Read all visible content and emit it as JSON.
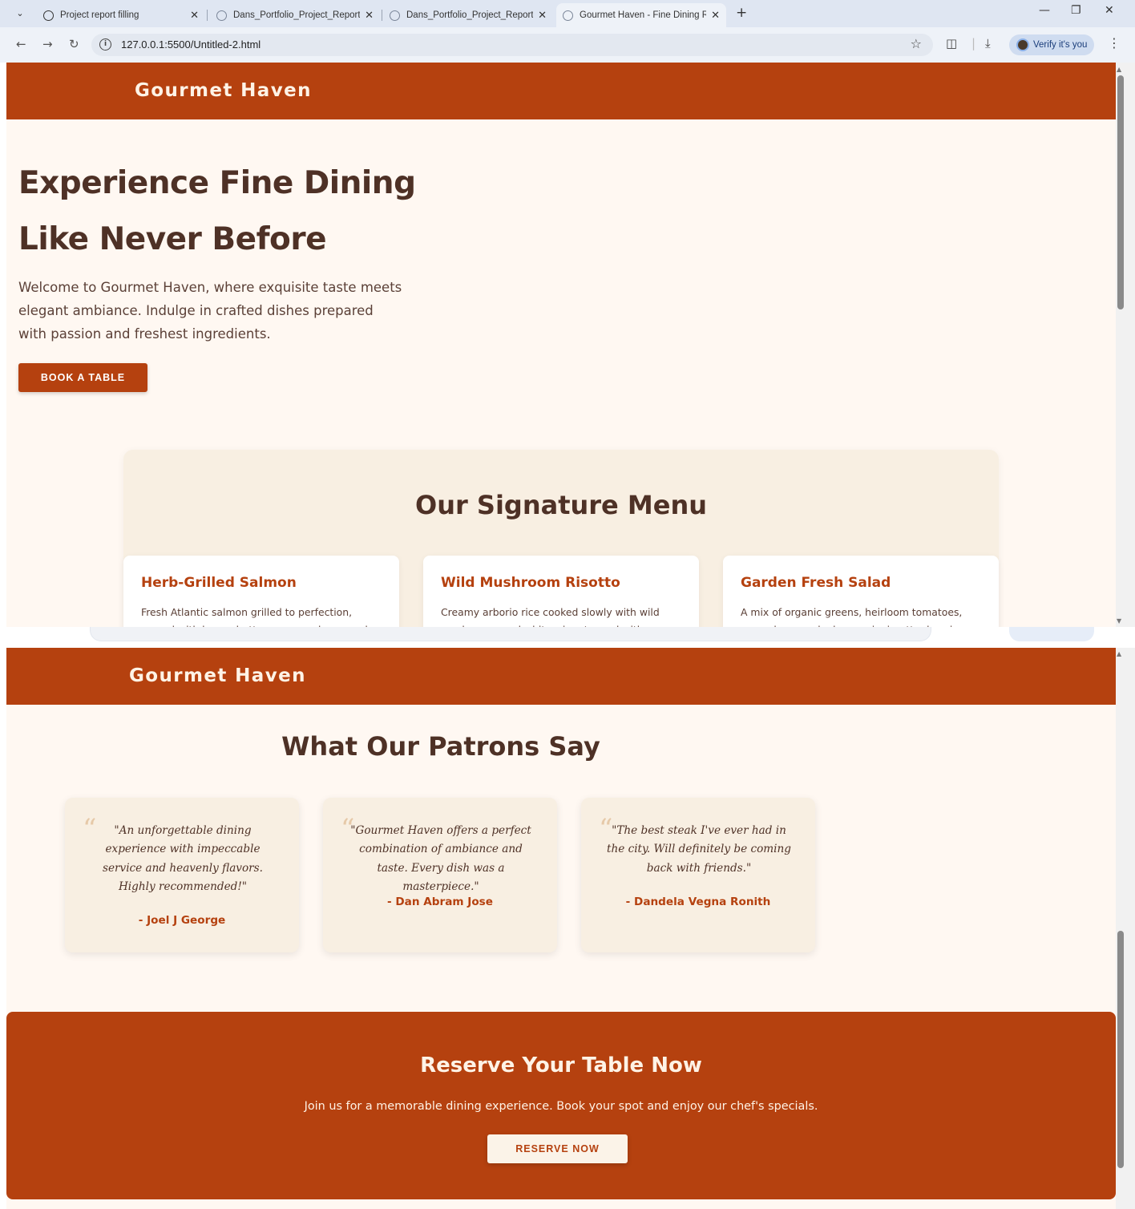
{
  "browser": {
    "tabs": [
      {
        "label": "Project report filling",
        "active": false
      },
      {
        "label": "Dans_Portfolio_Project_Report_",
        "active": false
      },
      {
        "label": "Dans_Portfolio_Project_Report.",
        "active": false
      },
      {
        "label": "Gourmet Haven - Fine Dining R",
        "active": true
      }
    ],
    "url": "127.0.0.1:5500/Untitled-2.html",
    "profile_label": "Verify it's you"
  },
  "colors": {
    "accent": "#b5410f",
    "page_bg": "#fff8f2",
    "card_bg": "#f8efe2",
    "heading": "#4e3126"
  },
  "header": {
    "brand": "Gourmet Haven"
  },
  "hero": {
    "title_line1": "Experience Fine Dining",
    "title_line2": "Like Never Before",
    "text": "Welcome to Gourmet Haven, where exquisite taste meets elegant ambiance. Indulge in crafted dishes prepared with passion and freshest ingredients.",
    "cta": "BOOK A TABLE"
  },
  "menu": {
    "title": "Our Signature Menu",
    "items": [
      {
        "name": "Herb-Grilled Salmon",
        "description": "Fresh Atlantic salmon grilled to perfection, served with lemon butter sauce and seasonal greens."
      },
      {
        "name": "Wild Mushroom Risotto",
        "description": "Creamy arborio rice cooked slowly with wild mushrooms and white wine, topped with Parmesan."
      },
      {
        "name": "Garden Fresh Salad",
        "description": "A mix of organic greens, heirloom tomatoes, cucumbers, and a house vinaigrette dressing."
      }
    ]
  },
  "testimonials": {
    "title": "What Our Patrons Say",
    "items": [
      {
        "quote": "\"An unforgettable dining experience with impeccable service and heavenly flavors. Highly recommended!\"",
        "author": "- Joel J George"
      },
      {
        "quote": "\"Gourmet Haven offers a perfect combination of ambiance and taste. Every dish was a masterpiece.\"",
        "author": "- Dan Abram Jose"
      },
      {
        "quote": "\"The best steak I've ever had in the city. Will definitely be coming back with friends.\"",
        "author": "- Dandela Vegna Ronith"
      }
    ]
  },
  "reserve": {
    "title": "Reserve Your Table Now",
    "text": "Join us for a memorable dining experience. Book your spot and enjoy our chef's specials.",
    "cta": "RESERVE NOW"
  }
}
